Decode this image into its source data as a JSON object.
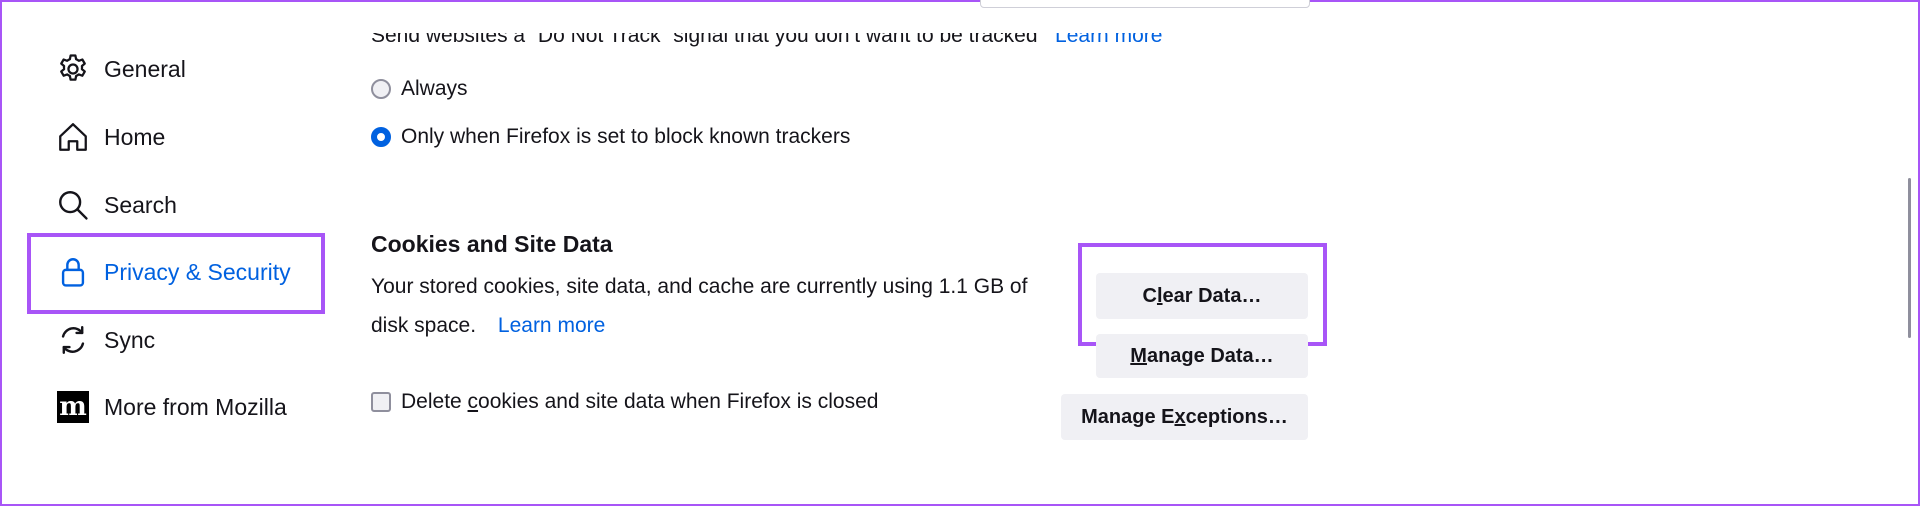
{
  "sidebar": {
    "items": [
      {
        "label": "General",
        "icon": "gear-icon"
      },
      {
        "label": "Home",
        "icon": "home-icon"
      },
      {
        "label": "Search",
        "icon": "search-icon"
      },
      {
        "label": "Privacy & Security",
        "icon": "lock-icon",
        "active": true
      },
      {
        "label": "Sync",
        "icon": "sync-icon"
      },
      {
        "label": "More from Mozilla",
        "icon": "mozilla-icon"
      }
    ]
  },
  "dnt": {
    "cut_text": "Send websites a “Do Not Track” signal that you don’t want to be tracked",
    "learn_more": "Learn more",
    "options": [
      {
        "label": "Always",
        "checked": false
      },
      {
        "label": "Only when Firefox is set to block known trackers",
        "checked": true
      }
    ]
  },
  "cookies": {
    "title": "Cookies and Site Data",
    "description_line1": "Your stored cookies, site data, and cache are currently using 1.1 GB of",
    "description_line2": "disk space.",
    "learn_more": "Learn more",
    "checkbox_label_pre": "Delete ",
    "checkbox_label_accel": "c",
    "checkbox_label_post": "ookies and site data when Firefox is closed",
    "buttons": {
      "clear_pre": "C",
      "clear_accel": "l",
      "clear_post": "ear Data…",
      "manage_accel": "M",
      "manage_post": "anage Data…",
      "exceptions_pre": "Manage E",
      "exceptions_accel": "x",
      "exceptions_post": "ceptions…"
    }
  },
  "colors": {
    "accent": "#0061e0",
    "highlight": "#a855f7",
    "button_bg": "#f0f0f4"
  }
}
